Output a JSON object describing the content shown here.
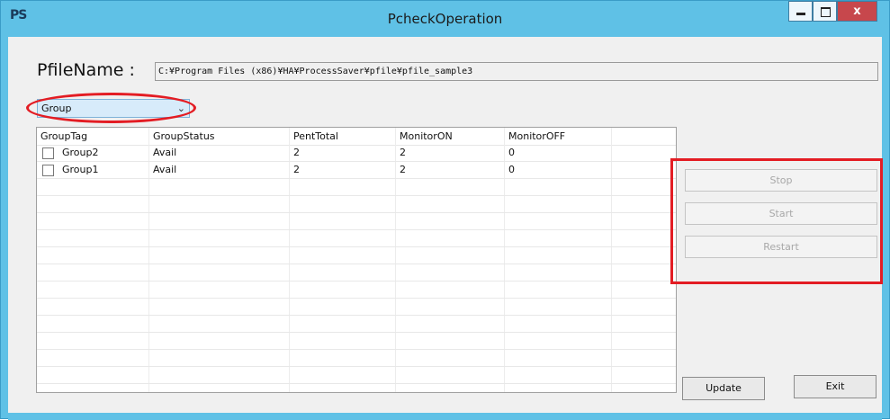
{
  "window": {
    "app_icon": "PS",
    "title": "PcheckOperation",
    "controls": {
      "minimize": "minimize-icon",
      "maximize": "maximize-icon",
      "close_label": "x"
    }
  },
  "pfile": {
    "label": "PfileName :",
    "value": "C:¥Program Files (x86)¥HA¥ProcessSaver¥pfile¥pfile_sample3"
  },
  "selector": {
    "value": "Group"
  },
  "table": {
    "columns": [
      "GroupTag",
      "GroupStatus",
      "PentTotal",
      "MonitorON",
      "MonitorOFF"
    ],
    "rows": [
      {
        "tag": "Group2",
        "status": "Avail",
        "pent_total": "2",
        "monitor_on": "2",
        "monitor_off": "0"
      },
      {
        "tag": "Group1",
        "status": "Avail",
        "pent_total": "2",
        "monitor_on": "2",
        "monitor_off": "0"
      }
    ]
  },
  "actions": {
    "stop": "Stop",
    "start": "Start",
    "restart": "Restart"
  },
  "footer": {
    "update": "Update",
    "exit": "Exit"
  },
  "annotation_color": "#e31c23"
}
